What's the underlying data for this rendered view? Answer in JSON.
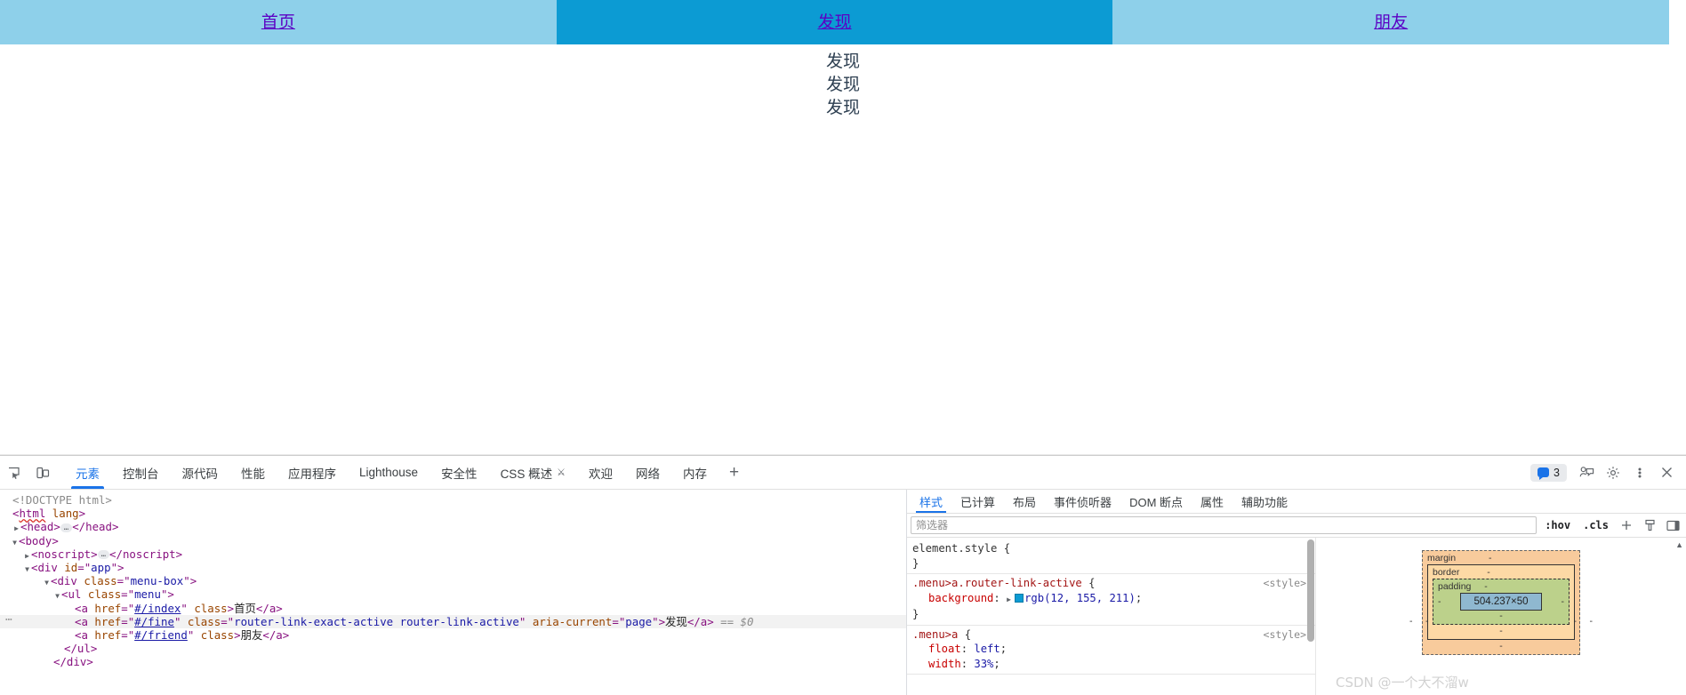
{
  "page": {
    "menu": [
      {
        "label": "首页",
        "href": "#/index",
        "active": false
      },
      {
        "label": "发现",
        "href": "#/fine",
        "active": true
      },
      {
        "label": "朋友",
        "href": "#/friend",
        "active": false
      }
    ],
    "content_lines": [
      "发现",
      "发现",
      "发现"
    ]
  },
  "devtools": {
    "toolbar": {
      "inspect_icon": "inspect-cursor-icon",
      "device_icon": "device-toolbar-icon",
      "tabs": [
        {
          "label": "元素",
          "active": true
        },
        {
          "label": "控制台",
          "active": false
        },
        {
          "label": "源代码",
          "active": false
        },
        {
          "label": "性能",
          "active": false
        },
        {
          "label": "应用程序",
          "active": false
        },
        {
          "label": "Lighthouse",
          "active": false
        },
        {
          "label": "安全性",
          "active": false
        },
        {
          "label": "CSS 概述",
          "active": false,
          "suffix_icon": "flask-icon"
        },
        {
          "label": "欢迎",
          "active": false
        },
        {
          "label": "网络",
          "active": false
        },
        {
          "label": "内存",
          "active": false
        }
      ],
      "add_tab_label": "+",
      "message_count": "3",
      "feedback_icon": "feedback-icon",
      "settings_icon": "gear-icon",
      "more_icon": "kebab-menu-icon",
      "close_icon": "close-icon"
    },
    "dom_tree": {
      "doctype": "<!DOCTYPE html>",
      "lines": [
        {
          "indent": 0,
          "tri": "none",
          "text": "doctype"
        },
        {
          "indent": 0,
          "tri": "none",
          "text": "html"
        },
        {
          "indent": 0,
          "tri": "closed",
          "text": "head"
        },
        {
          "indent": 0,
          "tri": "open",
          "text": "body"
        },
        {
          "indent": 1,
          "tri": "closed",
          "text": "noscript"
        },
        {
          "indent": 1,
          "tri": "open",
          "text": "divapp"
        },
        {
          "indent": 2,
          "tri": "open",
          "text": "menubox"
        },
        {
          "indent": 3,
          "tri": "open",
          "text": "ulmenu"
        },
        {
          "indent": 4,
          "tri": "none",
          "text": "a_index"
        },
        {
          "indent": 4,
          "tri": "none",
          "text": "a_fine",
          "selected": true
        },
        {
          "indent": 4,
          "tri": "none",
          "text": "a_friend"
        },
        {
          "indent": 3,
          "tri": "none",
          "text": "ulclose"
        },
        {
          "indent": 2,
          "tri": "none",
          "text": "divclose"
        }
      ],
      "html_tag": "html",
      "html_attr": "lang",
      "head_tag": "head",
      "body_tag": "body",
      "noscript_tag": "noscript",
      "div_tag": "div",
      "div_app_attr": "id",
      "div_app_val": "app",
      "div_menubox_attr": "class",
      "div_menubox_val": "menu-box",
      "ul_tag": "ul",
      "ul_attr": "class",
      "ul_val": "menu",
      "a_tag": "a",
      "href_attr": "href",
      "class_attr": "class",
      "aria_attr": "aria-current",
      "aria_val": "page",
      "link1_href": "#/index",
      "link1_text": "首页",
      "link2_href": "#/fine",
      "link2_class": "router-link-exact-active router-link-active",
      "link2_text": "发现",
      "link3_href": "#/friend",
      "link3_text": "朋友",
      "selected_marker": "== $0",
      "ellipsis": "…"
    },
    "styles": {
      "tabs": [
        {
          "label": "样式",
          "active": true
        },
        {
          "label": "已计算",
          "active": false
        },
        {
          "label": "布局",
          "active": false
        },
        {
          "label": "事件侦听器",
          "active": false
        },
        {
          "label": "DOM 断点",
          "active": false
        },
        {
          "label": "属性",
          "active": false
        },
        {
          "label": "辅助功能",
          "active": false
        }
      ],
      "filter_placeholder": "筛选器",
      "filter_value": "",
      "hov_label": ":hov",
      "cls_label": ".cls",
      "new_rule_icon": "plus-icon",
      "pen_icon": "style-pen-icon",
      "sidebar_icon": "toggle-sidebar-icon",
      "rules": [
        {
          "selector": "element.style",
          "origin": "",
          "declarations": []
        },
        {
          "selector": ".menu>a.router-link-active",
          "origin": "<style>",
          "declarations": [
            {
              "name": "background",
              "value": "rgb(12, 155, 211)",
              "swatch": "#0c9bd3",
              "has_arrow": true
            }
          ]
        },
        {
          "selector": ".menu>a",
          "origin": "<style>",
          "declarations": [
            {
              "name": "float",
              "value": "left",
              "swatch": "",
              "has_arrow": false
            },
            {
              "name": "width",
              "value": "33%",
              "swatch": "",
              "has_arrow": false
            }
          ]
        }
      ]
    },
    "box_model": {
      "margin_label": "margin",
      "border_label": "border",
      "padding_label": "padding",
      "content_size": "504.237×50",
      "dash": "-",
      "watermark": "CSDN @一个大不溜w"
    }
  },
  "colors": {
    "menu_inactive_bg": "#8ed0ea",
    "menu_active_bg": "#0c9bd3",
    "link_color": "#5b00c4",
    "devtools_accent": "#1a73e8"
  }
}
